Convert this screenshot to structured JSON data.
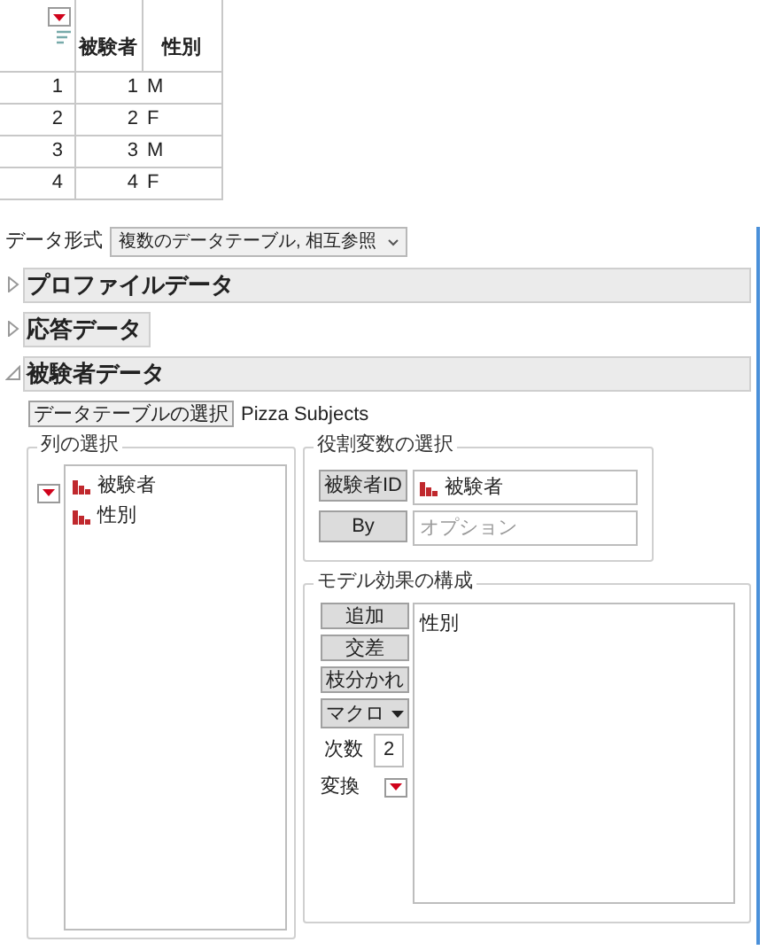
{
  "table": {
    "columns": [
      "被験者",
      "性別"
    ],
    "rows": [
      {
        "row_number": "1",
        "cells": [
          "1",
          "M"
        ]
      },
      {
        "row_number": "2",
        "cells": [
          "2",
          "F"
        ]
      },
      {
        "row_number": "3",
        "cells": [
          "3",
          "M"
        ]
      },
      {
        "row_number": "4",
        "cells": [
          "4",
          "F"
        ]
      }
    ]
  },
  "data_format": {
    "label": "データ形式",
    "value": "複数のデータテーブル, 相互参照"
  },
  "sections": [
    {
      "title": "プロファイルデータ",
      "expanded": false,
      "full_width": true
    },
    {
      "title": "応答データ",
      "expanded": false,
      "full_width": false
    },
    {
      "title": "被験者データ",
      "expanded": true,
      "full_width": true
    }
  ],
  "table_select": {
    "button": "データテーブルの選択",
    "value": "Pizza Subjects"
  },
  "column_select": {
    "title": "列の選択",
    "items": [
      "被験者",
      "性別"
    ]
  },
  "roles": {
    "title": "役割変数の選択",
    "rows": [
      {
        "button": "被験者ID",
        "value": "被験者",
        "placeholder": ""
      },
      {
        "button": "By",
        "value": "",
        "placeholder": "オプション"
      }
    ]
  },
  "model": {
    "title": "モデル効果の構成",
    "buttons": [
      "追加",
      "交差",
      "枝分かれ"
    ],
    "macro": "マクロ",
    "degree_label": "次数",
    "degree": "2",
    "transform_label": "変換",
    "effects": [
      "性別"
    ]
  }
}
